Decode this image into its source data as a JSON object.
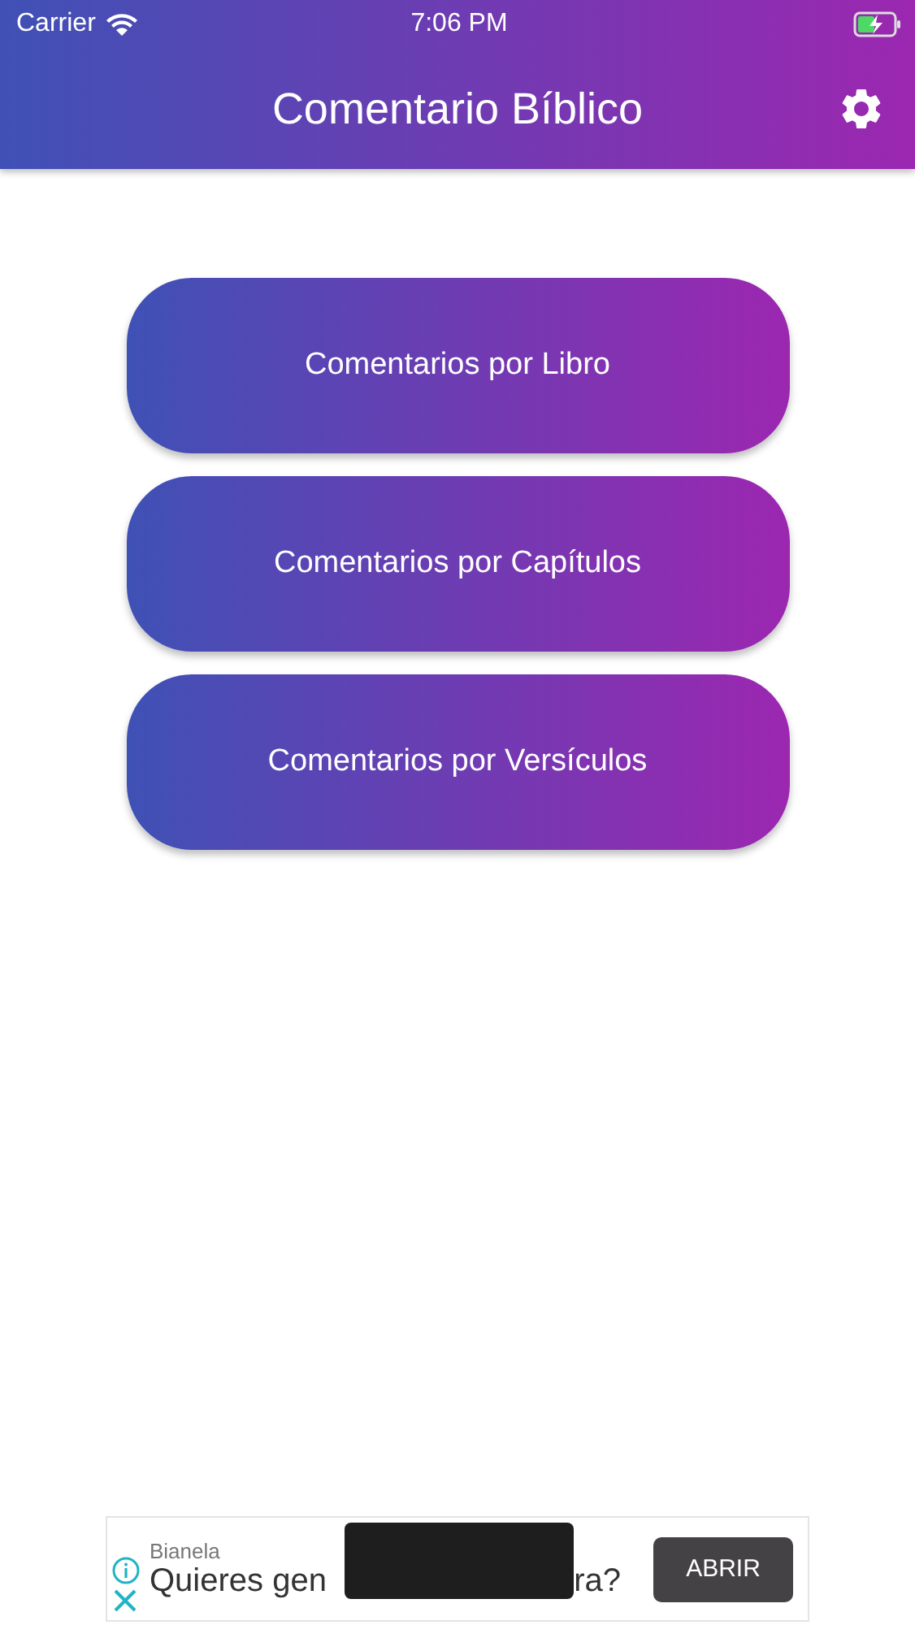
{
  "status_bar": {
    "carrier": "Carrier",
    "time": "7:06 PM"
  },
  "app_bar": {
    "title": "Comentario Bíblico"
  },
  "menu_buttons": [
    {
      "label": "Comentarios por Libro"
    },
    {
      "label": "Comentarios por Capítulos"
    },
    {
      "label": "Comentarios por Versículos"
    }
  ],
  "ad_banner": {
    "advertiser": "Bianela",
    "headline_start": "Quieres gen",
    "headline_end": "ra?",
    "button": "ABRIR"
  }
}
